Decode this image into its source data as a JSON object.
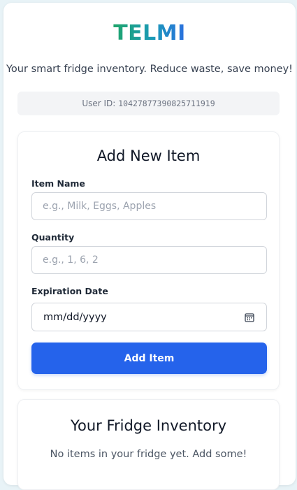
{
  "app": {
    "logo": "TELMI",
    "tagline": "Your smart fridge inventory. Reduce waste, save money!",
    "user_label": "User ID:",
    "user_id": "10427877390825711919"
  },
  "add_form": {
    "title": "Add New Item",
    "item_name": {
      "label": "Item Name",
      "placeholder": "e.g., Milk, Eggs, Apples",
      "value": ""
    },
    "quantity": {
      "label": "Quantity",
      "placeholder": "e.g., 1, 6, 2",
      "value": ""
    },
    "expiration": {
      "label": "Expiration Date",
      "value": "mm/dd/yyyy",
      "icon": "calendar-icon"
    },
    "submit_label": "Add Item"
  },
  "inventory": {
    "title": "Your Fridge Inventory",
    "empty_message": "No items in your fridge yet. Add some!"
  },
  "colors": {
    "accent": "#2563eb",
    "logo_gradient": [
      "#1fa56a",
      "#1b9ab8",
      "#2b6fe0"
    ],
    "background": "#e8f3f7"
  }
}
